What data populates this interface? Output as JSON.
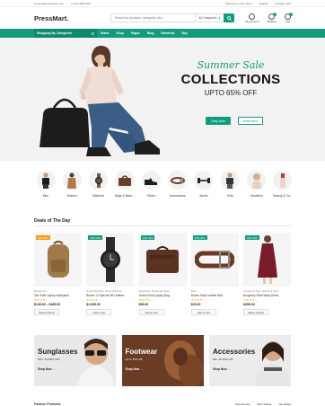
{
  "topbar": {
    "email": "support@pressmart.com",
    "phone": "(+123) 4567 890",
    "welcome": "Welcome to Our Store",
    "language": "English",
    "currency": "$ Dollar (US)"
  },
  "header": {
    "logo": "PressMart.",
    "search_placeholder": "Search for products, categories, sku...",
    "category_select": "All Categories",
    "account_label": "My Account",
    "wishlist_label": "Wishlist",
    "wishlist_count": "0",
    "cart_label": "Cart",
    "cart_count": "0"
  },
  "nav": {
    "categories_label": "Shopping By Categories",
    "items": [
      "Home",
      "Shop",
      "Pages",
      "Blog",
      "Elements",
      "Buy"
    ]
  },
  "hero": {
    "subtitle": "Summer Sale",
    "title": "COLLECTIONS",
    "offer": "UPTO 65% OFF",
    "primary_button": "Shop Now",
    "secondary_button": "Read More"
  },
  "categories": [
    {
      "label": "Men",
      "icon": "man-icon"
    },
    {
      "label": "Women",
      "icon": "woman-icon"
    },
    {
      "label": "Watches",
      "icon": "watch-icon"
    },
    {
      "label": "Bags & Back...",
      "icon": "bag-icon"
    },
    {
      "label": "Shoes",
      "icon": "shoe-icon"
    },
    {
      "label": "Accessories",
      "icon": "belt-icon"
    },
    {
      "label": "Sports",
      "icon": "dumbbell-icon"
    },
    {
      "label": "Kids",
      "icon": "kid-icon"
    },
    {
      "label": "Jewellery",
      "icon": "jewellery-icon"
    },
    {
      "label": "Beauty & Ca...",
      "icon": "beauty-icon"
    }
  ],
  "deals": {
    "title": "Deals of The Day",
    "products": [
      {
        "badge": "16% OFF",
        "brand": "Backpacks",
        "name": "Tan Solid Laptop Backpack",
        "stars": "★★★★☆",
        "price": "$149.00 – $185.00",
        "button": "Select options"
      },
      {
        "badge": "16% OFF",
        "brand": "Smart Watches, Smart Watches",
        "name": "Brown 12 Special HB Leather...",
        "stars": "★★★★☆",
        "price": "$1,099.00",
        "button": "Add to cart"
      },
      {
        "badge": "16% OFF",
        "brand": "Handbags, Messenger Bag",
        "name": "Brown Solid Laptop Bag",
        "stars": "★★★★☆",
        "price": "$99.00",
        "button": "Add to cart"
      },
      {
        "badge": "16% OFF",
        "brand": "Belts",
        "name": "Brown Solid Leather Belt",
        "stars": "★★★★☆",
        "price": "$15.00",
        "button": "Add to cart"
      },
      {
        "badge": "16% OFF",
        "brand": "Dresses & Tops, Events & Party",
        "name": "Burgundy Solid Wrap Dress",
        "stars": "★★★★☆",
        "price": "$395.00",
        "button": "Select options"
      }
    ]
  },
  "banners": [
    {
      "title": "Sunglasses",
      "sub": "MIN. 40–80% OFF",
      "link": "Shop Now"
    },
    {
      "title": "Footwear",
      "sub": "Up to 70% Off",
      "link": "Shop Now"
    },
    {
      "title": "Accessories",
      "sub": "Min. 40–80% Off",
      "link": "Shop Now"
    }
  ],
  "fashion": {
    "title": "Fashion Products",
    "tabs": [
      "New Arrivals",
      "Best Selling",
      "Top Rated"
    ]
  },
  "colors": {
    "accent": "#119c7d",
    "badge_orange": "#f39c12"
  }
}
